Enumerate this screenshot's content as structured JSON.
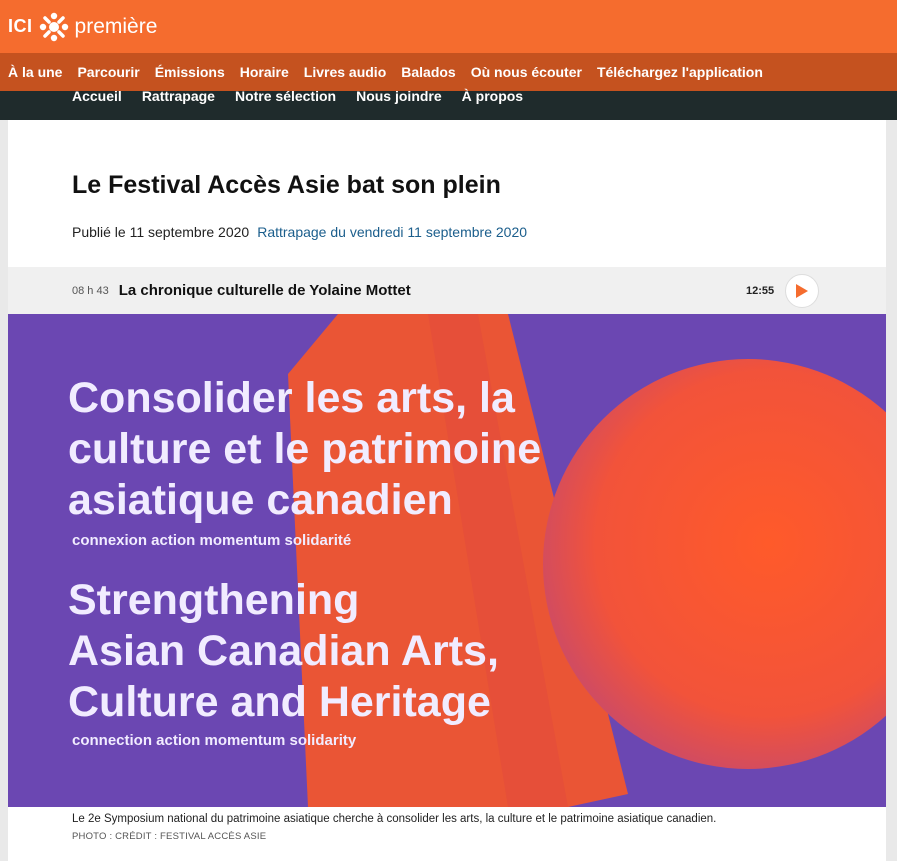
{
  "brand": {
    "ici": "ICI",
    "name": "première",
    "colors": {
      "orange": "#f56c2e",
      "nav": "#c5521f",
      "subnav": "#1f2b2c",
      "link": "#1b5e8c"
    }
  },
  "main_nav": [
    "À la une",
    "Parcourir",
    "Émissions",
    "Horaire",
    "Livres audio",
    "Balados",
    "Où nous écouter",
    "Téléchargez l'application"
  ],
  "sub_nav": [
    "Accueil",
    "Rattrapage",
    "Notre sélection",
    "Nous joindre",
    "À propos"
  ],
  "article": {
    "title": "Le Festival Accès Asie bat son plein",
    "published": "Publié le 11 septembre 2020",
    "catchup_link": "Rattrapage du vendredi 11 septembre 2020"
  },
  "segment": {
    "time": "08 h 43",
    "title": "La chronique culturelle de Yolaine Mottet",
    "duration": "12:55",
    "play_icon": "play-icon"
  },
  "hero": {
    "fr_line1": "Consolider les arts, la",
    "fr_line2": "culture et le patrimoine",
    "fr_line3": "asiatique canadien",
    "fr_tags": "connexion   action   momentum   solidarité",
    "en_line1": "Strengthening",
    "en_line2": "Asian Canadian Arts,",
    "en_line3": "Culture and Heritage",
    "en_tags": "connection   action   momentum   solidarity"
  },
  "caption": "Le 2e Symposium national du patrimoine asiatique cherche à consolider les arts, la culture et le patrimoine asiatique canadien.",
  "credit": "PHOTO : CRÉDIT : FESTIVAL ACCÈS ASIE"
}
